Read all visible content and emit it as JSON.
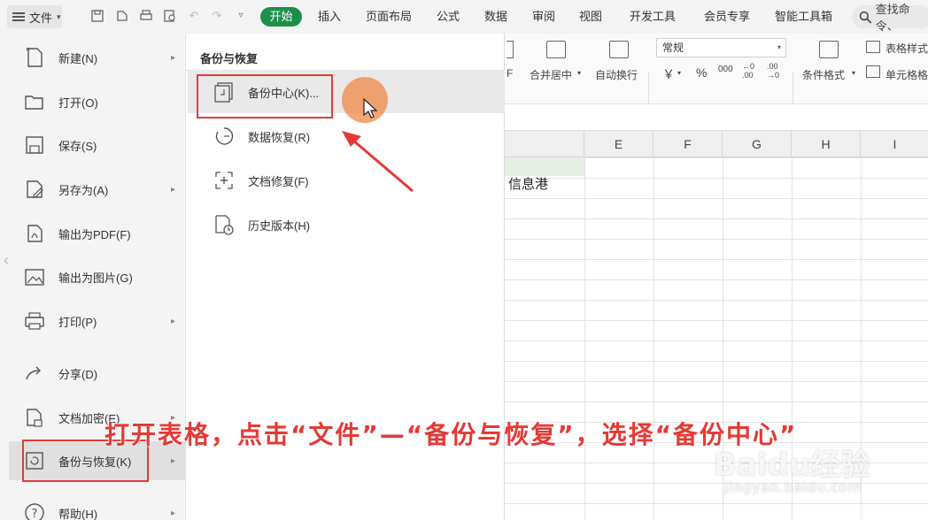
{
  "menubar": {
    "file_label": "文件",
    "tabs": [
      "开始",
      "插入",
      "页面布局",
      "公式",
      "数据",
      "审阅",
      "视图",
      "开发工具",
      "会员专享",
      "智能工具箱"
    ],
    "search_text": "查找命令、"
  },
  "ribbon": {
    "merge_center": "合并居中",
    "wrap_text": "自动换行",
    "number_format": "常规",
    "currency": "￥",
    "percent": "%",
    "thousands": "000",
    "dec_inc": "←0\n.00",
    "dec_dec": ".00\n→0",
    "conditional_format": "条件格式",
    "table_style": "表格样式",
    "cell_format": "单元格格"
  },
  "sheet": {
    "columns": [
      "E",
      "F",
      "G",
      "H",
      "I"
    ],
    "cell_text": "信息港"
  },
  "file_menu": {
    "items": [
      {
        "label": "新建(N)",
        "icon": "new-file-icon",
        "has_arrow": true
      },
      {
        "label": "打开(O)",
        "icon": "folder-open-icon",
        "has_arrow": false
      },
      {
        "label": "保存(S)",
        "icon": "save-icon",
        "has_arrow": false
      },
      {
        "label": "另存为(A)",
        "icon": "save-as-icon",
        "has_arrow": true
      },
      {
        "label": "输出为PDF(F)",
        "icon": "pdf-export-icon",
        "has_arrow": false
      },
      {
        "label": "输出为图片(G)",
        "icon": "image-export-icon",
        "has_arrow": false
      },
      {
        "label": "打印(P)",
        "icon": "printer-icon",
        "has_arrow": true
      },
      {
        "label": "分享(D)",
        "icon": "share-icon",
        "has_arrow": false
      },
      {
        "label": "文档加密(E)",
        "icon": "lock-document-icon",
        "has_arrow": true
      },
      {
        "label": "备份与恢复(K)",
        "icon": "backup-restore-icon",
        "has_arrow": true
      },
      {
        "label": "帮助(H)",
        "icon": "help-icon",
        "has_arrow": true
      }
    ]
  },
  "submenu": {
    "title": "备份与恢复",
    "items": [
      {
        "label": "备份中心(K)...",
        "icon": "backup-center-icon"
      },
      {
        "label": "数据恢复(R)",
        "icon": "data-recovery-icon"
      },
      {
        "label": "文档修复(F)",
        "icon": "document-repair-icon"
      },
      {
        "label": "历史版本(H)",
        "icon": "history-version-icon"
      }
    ]
  },
  "annotation": {
    "caption": "打开表格，点击“文件”—“备份与恢复”，选择“备份中心”",
    "highlight_color": "#e53b3b"
  },
  "watermark": {
    "brand": "Baidu经验",
    "url": "jingyan.baidu.com"
  },
  "colors": {
    "accent_green": "#1d8f4a",
    "annotation_red": "#e53935"
  }
}
